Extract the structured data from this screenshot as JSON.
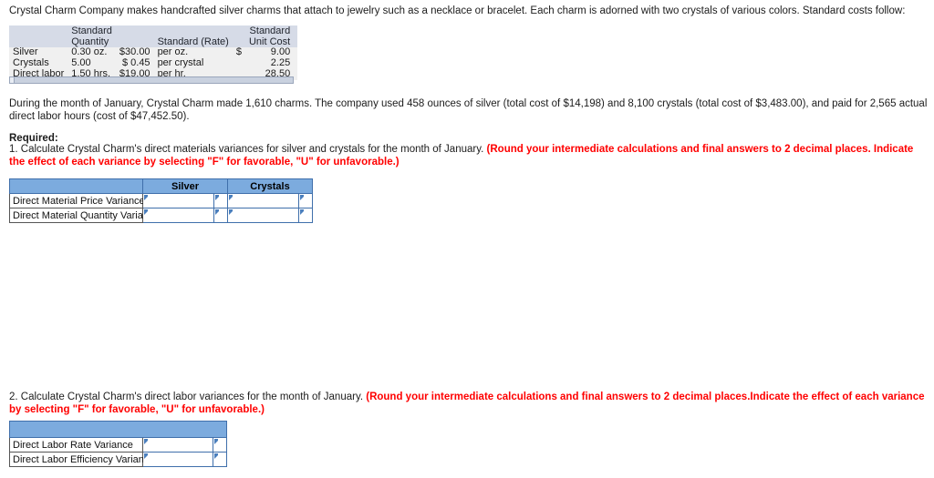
{
  "intro": {
    "paragraph": "Crystal Charm Company makes handcrafted silver charms that attach to jewelry such as a necklace or bracelet. Each charm is adorned with two crystals of various colors. Standard costs follow:"
  },
  "standard_cost_table": {
    "headers": {
      "blank": "",
      "quantity_line1": "Standard",
      "quantity_line2": "Quantity",
      "rate": "Standard (Rate)",
      "unit_line1": "Standard",
      "unit_line2": "Unit Cost"
    },
    "rows": [
      {
        "label": "Silver",
        "quantity": "0.30 oz.",
        "rate_amount": "$30.00",
        "rate_unit": "per oz.",
        "unit_cost_symbol": "$",
        "unit_cost": "9.00"
      },
      {
        "label": "Crystals",
        "quantity": "5.00",
        "rate_amount": "$  0.45",
        "rate_unit": "per crystal",
        "unit_cost_symbol": "",
        "unit_cost": "2.25"
      },
      {
        "label": "Direct labor",
        "quantity": "1.50 hrs.",
        "rate_amount": "$19.00",
        "rate_unit": "per hr.",
        "unit_cost_symbol": "",
        "unit_cost": "28.50"
      }
    ]
  },
  "usage": {
    "paragraph": "During the month of January, Crystal Charm made 1,610 charms. The company used 458 ounces of silver (total cost of $14,198) and 8,100 crystals (total cost of $3,483.00), and paid for 2,565 actual direct labor hours (cost of $47,452.50)."
  },
  "required": {
    "heading": "Required:",
    "item1_black": "1. Calculate Crystal Charm's direct materials variances for silver and crystals for the month of January.",
    "item1_red": "(Round your intermediate calculations and final answers to 2 decimal places. Indicate the effect of each variance by selecting \"F\" for favorable, \"U\" for unfavorable.)",
    "item2_black": "2. Calculate Crystal Charm's direct labor variances for the month of January.",
    "item2_red": "(Round your intermediate calculations and final answers to 2 decimal places.Indicate the effect of each variance by selecting \"F\" for favorable, \"U\" for unfavorable.)"
  },
  "materials_answer_table": {
    "headers": [
      "",
      "Silver",
      "",
      "Crystals",
      ""
    ],
    "rows": [
      {
        "label": "Direct Material Price Variance",
        "silver_value": "",
        "silver_effect": "",
        "crystals_value": "",
        "crystals_effect": ""
      },
      {
        "label": "Direct Material Quantity Variance",
        "silver_value": "",
        "silver_effect": "",
        "crystals_value": "",
        "crystals_effect": ""
      }
    ]
  },
  "labor_answer_table": {
    "headers": [
      "",
      "",
      ""
    ],
    "rows": [
      {
        "label": "Direct Labor Rate Variance",
        "value": "",
        "effect": ""
      },
      {
        "label": "Direct Labor Efficiency Variance",
        "value": "",
        "effect": ""
      }
    ]
  },
  "colors": {
    "header_blue": "#7cabde",
    "table_header_gray": "#d6dbe7",
    "table_body_gray": "#f0f0f0",
    "red_instruction": "#ff0000",
    "cell_border_blue": "#3f6fab"
  }
}
